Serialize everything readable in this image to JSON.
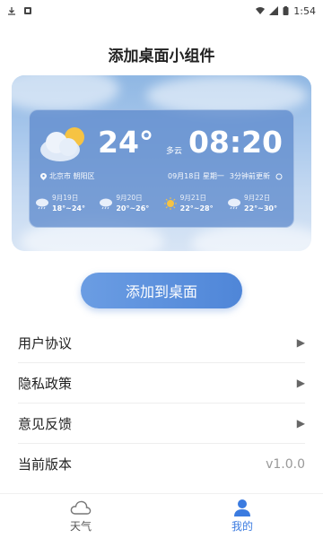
{
  "status_bar": {
    "time": "1:54"
  },
  "page": {
    "title": "添加桌面小组件"
  },
  "widget": {
    "temperature": "24°",
    "condition": "多云",
    "time": "08:20",
    "location": "北京市 朝阳区",
    "date": "09月18日 星期一",
    "updated": "3分钟前更新",
    "forecast": [
      {
        "date": "9月19日",
        "range": "18°~24°",
        "icon": "cloud-rain-icon"
      },
      {
        "date": "9月20日",
        "range": "20°~26°",
        "icon": "cloud-rain-icon"
      },
      {
        "date": "9月21日",
        "range": "22°~28°",
        "icon": "sun-icon"
      },
      {
        "date": "9月22日",
        "range": "22°~30°",
        "icon": "cloud-rain-icon"
      }
    ]
  },
  "add_button": {
    "label": "添加到桌面"
  },
  "menu": {
    "items": [
      {
        "label": "用户协议"
      },
      {
        "label": "隐私政策"
      },
      {
        "label": "意见反馈"
      },
      {
        "label": "当前版本",
        "value": "v1.0.0"
      }
    ]
  },
  "tabs": [
    {
      "label": "天气",
      "icon": "cloud-icon"
    },
    {
      "label": "我的",
      "icon": "person-icon",
      "active": true
    }
  ],
  "colors": {
    "accent": "#3b7be0",
    "button": "#5a8fdc"
  }
}
